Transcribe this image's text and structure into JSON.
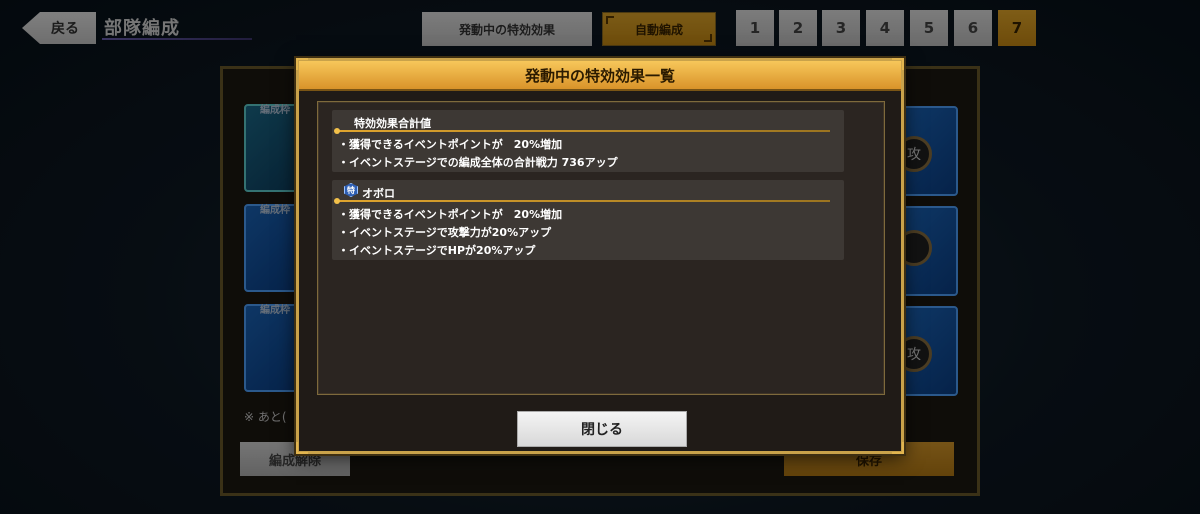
{
  "header": {
    "back_label": "戻る",
    "title": "部隊編成",
    "effects_button": "発動中の特効効果",
    "auto_button": "自動編成",
    "tabs": [
      "1",
      "2",
      "3",
      "4",
      "5",
      "6",
      "7"
    ],
    "active_tab": "7"
  },
  "background": {
    "slot_label": "編成枠",
    "remaining_text": "※ あと(",
    "release_button": "編成解除",
    "save_button": "保存",
    "right_circle_glyph": "攻"
  },
  "modal": {
    "title": "発動中の特効効果一覧",
    "summary": {
      "title": "特効効果合計値",
      "items": [
        "・獲得できるイベントポイントが　20%増加",
        "・イベントステージでの編成全体の合計戦力 736アップ"
      ]
    },
    "character": {
      "badge": "特",
      "name": "オボロ",
      "items": [
        "・獲得できるイベントポイントが　20%増加",
        "・イベントステージで攻撃力が20%アップ",
        "・イベントステージでHPが20%アップ"
      ]
    },
    "close_button": "閉じる"
  },
  "colors": {
    "accent_gold": "#e0a52e",
    "slot_blue": "#1a64b8",
    "modal_bg": "#201b17"
  }
}
